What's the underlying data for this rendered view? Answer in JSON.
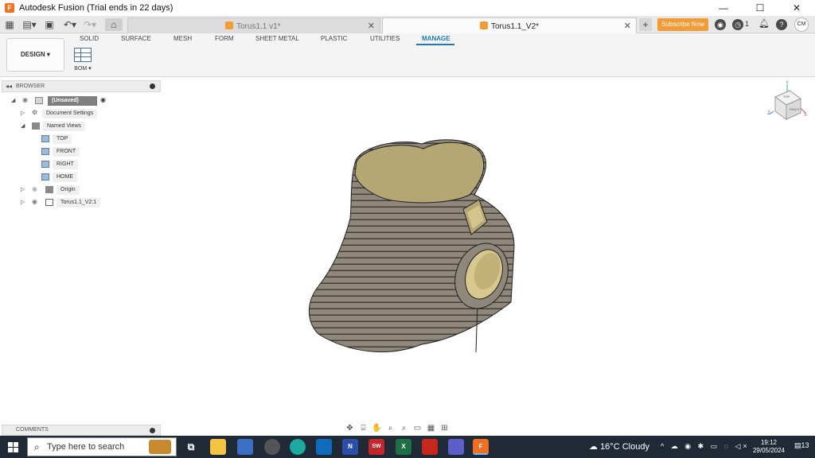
{
  "window": {
    "title": "Autodesk Fusion (Trial ends in 22 days)",
    "app_icon": "F",
    "minimize": "—",
    "maximize": "☐",
    "close": "✕"
  },
  "tabs": [
    {
      "label": "Torus1.1 v1*",
      "active": false
    },
    {
      "label": "Torus1.1_V2*",
      "active": true
    }
  ],
  "header": {
    "subscribe_label": "Subscribe Now",
    "job_count": "1",
    "avatar_initials": "CM"
  },
  "ribbon": {
    "workspace_label": "DESIGN ▾",
    "tabs": [
      "SOLID",
      "SURFACE",
      "MESH",
      "FORM",
      "SHEET METAL",
      "PLASTIC",
      "UTILITIES",
      "MANAGE"
    ],
    "active_tab": "MANAGE",
    "bom_label": "BOM ▾"
  },
  "browser": {
    "title": "BROWSER",
    "root_label": "(Unsaved)",
    "items": [
      {
        "label": "Document Settings"
      },
      {
        "label": "Named Views"
      },
      {
        "label": "TOP"
      },
      {
        "label": "FRONT"
      },
      {
        "label": "RIGHT"
      },
      {
        "label": "HOME"
      },
      {
        "label": "Origin"
      },
      {
        "label": "Torus1.1_V2:1"
      }
    ]
  },
  "viewcube": {
    "face_top": "TOP",
    "face_right": "RIGHT",
    "axis_y": "Y",
    "axis_x": "X",
    "axis_z": "Z"
  },
  "comments": {
    "title": "COMMENTS"
  },
  "taskbar": {
    "search_placeholder": "Type here to search",
    "weather": "16°C  Cloudy",
    "time": "19:12",
    "date": "29/05/2024",
    "notification_count": "13",
    "apps": [
      "",
      "",
      "",
      "",
      "",
      "",
      "",
      "N",
      "SW",
      "X",
      "",
      "",
      "F"
    ]
  },
  "colors": {
    "accent": "#1f78c8",
    "brand": "#f26e21",
    "subscribe": "#f39b35",
    "model_side": "#8e877a",
    "model_top": "#b5a774",
    "taskbar": "#1f2a36"
  }
}
